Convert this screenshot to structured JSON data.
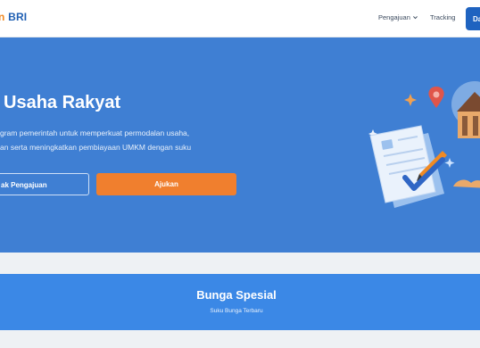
{
  "header": {
    "logo_prefix": "n",
    "logo_brand": "BRI",
    "nav": [
      {
        "label": "Pengajuan",
        "has_dropdown": true
      },
      {
        "label": "Tracking"
      }
    ],
    "cta_label": "Da"
  },
  "hero": {
    "title": "Usaha Rakyat",
    "desc_lines": [
      "gram pemerintah untuk memperkuat permodalan usaha,",
      "an serta meningkatkan pembiayaan UMKM dengan suku"
    ],
    "btn_secondary": "ak Pengajuan",
    "btn_primary": "Ajukan"
  },
  "banner": {
    "title": "Bunga Spesial",
    "subtitle": "Suku Bunga Terbaru"
  },
  "colors": {
    "hero_bg": "#3f7fd3",
    "banner_bg": "#3b88e6",
    "accent_orange": "#f07f2e",
    "brand_blue": "#1f5fb3"
  },
  "icons": [
    "chevron-down-icon",
    "location-pin-icon",
    "sparkle-icon",
    "checkmark-icon",
    "document-icon",
    "bank-building-icon"
  ]
}
